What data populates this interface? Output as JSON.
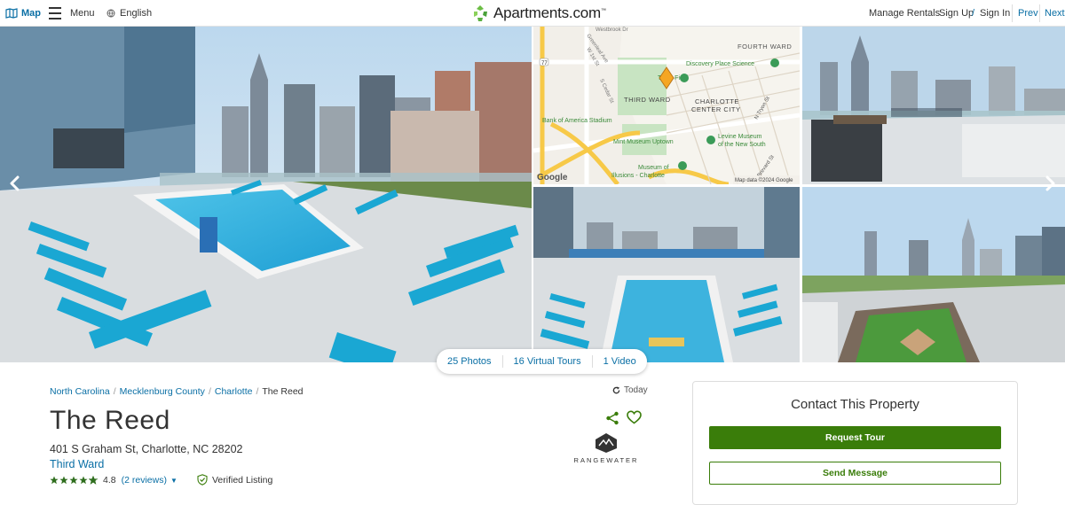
{
  "topbar": {
    "map_label": "Map",
    "menu_label": "Menu",
    "language_label": "English",
    "logo_text": "Apartments.com",
    "logo_tm": "™",
    "manage_rentals": "Manage Rentals",
    "sign_up": "Sign Up",
    "separator": "/",
    "sign_in": "Sign In",
    "prev": "Prev",
    "next": "Next"
  },
  "map": {
    "labels": {
      "fourth_ward": "FOURTH WARD",
      "discovery": "Discovery Place Science",
      "truist": "Truist Field",
      "third_ward": "THIRD WARD",
      "charlotte_center": "CHARLOTTE",
      "center_city": "CENTER CITY",
      "tryon": "N Tryon St",
      "boa_stadium": "Bank of America Stadium",
      "mint": "Mint Museum Uptown",
      "levine_1": "Levine Museum",
      "levine_2": "of the New South",
      "illusions_1": "Museum of",
      "illusions_2": "Illusions - Charlotte",
      "brevard": "Brevard St",
      "greenleaf": "Greenleaf Ave",
      "w_1st": "W 1st St",
      "cedar": "S Cedar St",
      "westbrook": "Westbrook Dr",
      "google": "Google",
      "map_data": "Map data ©2024 Google",
      "route": "77"
    }
  },
  "media": {
    "photos": "25 Photos",
    "tours": "16 Virtual Tours",
    "video": "1 Video"
  },
  "breadcrumb": {
    "items": [
      "North Carolina",
      "Mecklenburg County",
      "Charlotte"
    ],
    "current": "The Reed"
  },
  "updated": "Today",
  "property": {
    "name": "The Reed",
    "address": "401 S Graham St, Charlotte, NC 28202",
    "neighborhood": "Third Ward",
    "rating": 4.8,
    "rating_text": "4.8",
    "reviews_text": "(2 reviews)",
    "verified": "Verified Listing",
    "manager": "RANGEWATER"
  },
  "contact": {
    "heading": "Contact This Property",
    "tour_button": "Request Tour",
    "message_button": "Send Message"
  },
  "colors": {
    "link": "#0a6fa5",
    "primary_green": "#3a7d0a",
    "star": "#2f6e1e",
    "logo_green": "#6cbe45"
  },
  "icons": [
    "map-icon",
    "menu-icon",
    "globe-icon",
    "logo-icon",
    "chevron-left-icon",
    "chevron-right-icon",
    "refresh-icon",
    "share-icon",
    "heart-icon",
    "shield-check-icon",
    "star-icon"
  ]
}
